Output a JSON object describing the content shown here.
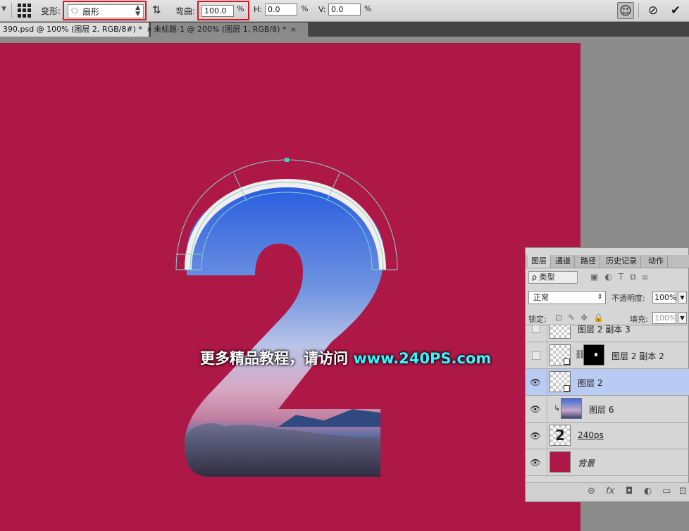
{
  "options_bar": {
    "warp_label": "变形:",
    "warp_style": "扇形",
    "bend_label": "弯曲:",
    "bend_value": "100.0",
    "bend_unit": "%",
    "h_label": "H:",
    "h_value": "0.0",
    "h_unit": "%",
    "v_label": "V:",
    "v_value": "0.0",
    "v_unit": "%",
    "cancel_glyph": "⊘",
    "commit_glyph": "✔"
  },
  "tabs": [
    {
      "label": "390.psd @ 100% (图层 2, RGB/8#) *",
      "close": "×"
    },
    {
      "label": "未标题-1 @ 200% (图层 1, RGB/8) *",
      "close": "×"
    }
  ],
  "canvas": {
    "background_color": "#ae1847",
    "watermark_text": "更多精品教程，请访问 ",
    "watermark_url": "www.240PS.com"
  },
  "layers_panel": {
    "tabs": [
      "图层",
      "通道",
      "路径",
      "历史记录",
      "动作"
    ],
    "filter_label": "ρ 类型",
    "blend_mode": "正常",
    "opacity_label": "不透明度:",
    "opacity_value": "100%",
    "lock_label": "锁定:",
    "fill_label": "填充:",
    "fill_value": "100%",
    "layers": [
      {
        "name": "图层 2 副本 3",
        "visible": false,
        "selected": false
      },
      {
        "name": "图层 2 副本 2",
        "visible": false,
        "selected": false,
        "has_mask": true
      },
      {
        "name": "图层 2",
        "visible": true,
        "selected": true
      },
      {
        "name": "图层 6",
        "visible": true,
        "selected": false,
        "clipped": true
      },
      {
        "name": "240ps",
        "visible": true,
        "selected": false,
        "thumb_text": "2"
      },
      {
        "name": "背景",
        "visible": true,
        "selected": false,
        "fill": "#ae1847"
      }
    ]
  }
}
